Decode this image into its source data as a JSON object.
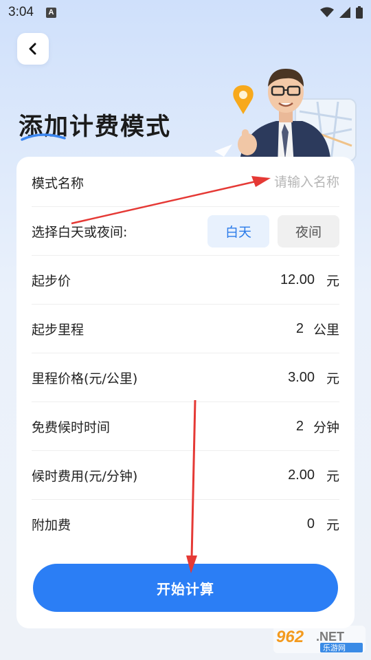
{
  "status_bar": {
    "time": "3:04",
    "notification_icon": "A"
  },
  "header": {
    "title": "添加计费模式"
  },
  "form": {
    "name": {
      "label": "模式名称",
      "placeholder": "请输入名称",
      "value": ""
    },
    "period": {
      "label": "选择白天或夜间:",
      "options": [
        "白天",
        "夜间"
      ],
      "selected": "白天"
    },
    "fields": [
      {
        "label": "起步价",
        "value": "12.00",
        "unit": "元"
      },
      {
        "label": "起步里程",
        "value": "2",
        "unit": "公里"
      },
      {
        "label": "里程价格(元/公里)",
        "value": "3.00",
        "unit": "元"
      },
      {
        "label": "免费候时时间",
        "value": "2",
        "unit": "分钟"
      },
      {
        "label": "候时费用(元/分钟)",
        "value": "2.00",
        "unit": "元"
      },
      {
        "label": "附加费",
        "value": "0",
        "unit": "元"
      }
    ],
    "submit_label": "开始计算"
  },
  "watermark": {
    "brand": "962",
    "suffix": ".NET",
    "sub": "乐游网"
  },
  "colors": {
    "accent": "#2b7ef5",
    "annotation_arrow": "#e53935"
  }
}
